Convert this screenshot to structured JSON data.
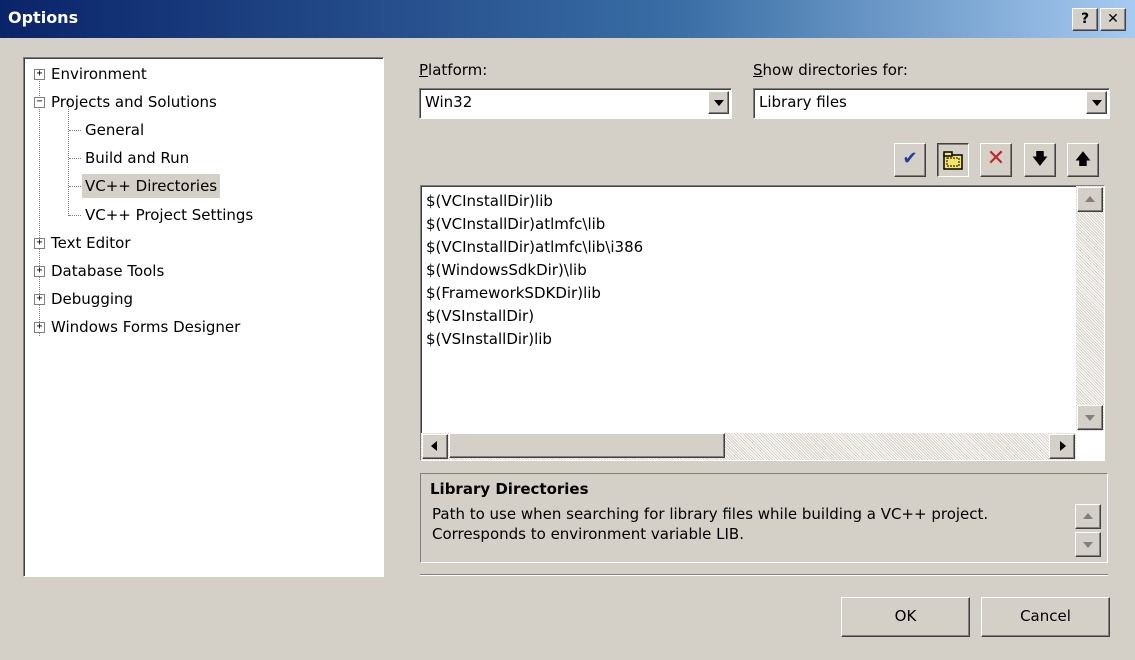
{
  "window": {
    "title": "Options",
    "help_label": "?",
    "close_label": "✕"
  },
  "tree": {
    "items": [
      {
        "label": "Environment",
        "expander": "+"
      },
      {
        "label": "Projects and Solutions",
        "expander": "−"
      },
      {
        "label": "General"
      },
      {
        "label": "Build and Run"
      },
      {
        "label": "VC++ Directories",
        "selected": true
      },
      {
        "label": "VC++ Project Settings"
      },
      {
        "label": "Text Editor",
        "expander": "+"
      },
      {
        "label": "Database Tools",
        "expander": "+"
      },
      {
        "label": "Debugging",
        "expander": "+"
      },
      {
        "label": "Windows Forms Designer",
        "expander": "+"
      }
    ]
  },
  "platform": {
    "label_first": "P",
    "label_rest": "latform:",
    "value": "Win32"
  },
  "show_dirs": {
    "label_first": "S",
    "label_rest": "how directories for:",
    "value": "Library files"
  },
  "toolbar": {
    "check_icon": "✔",
    "x_icon": "✕",
    "down_icon": "🡇",
    "up_icon": "🡅",
    "accent_check": "#1c3fa8",
    "accent_delete": "#c0282c",
    "accent_folder": "#f5e46a"
  },
  "directories": [
    "$(VCInstallDir)lib",
    "$(VCInstallDir)atlmfc\\lib",
    "$(VCInstallDir)atlmfc\\lib\\i386",
    "$(WindowsSdkDir)\\lib",
    "$(FrameworkSDKDir)lib",
    "$(VSInstallDir)",
    "$(VSInstallDir)lib"
  ],
  "description": {
    "title": "Library Directories",
    "line1": "Path to use when searching for library files while building a VC++ project.",
    "line2": "Corresponds to environment variable LIB."
  },
  "buttons": {
    "ok": "OK",
    "cancel": "Cancel"
  }
}
